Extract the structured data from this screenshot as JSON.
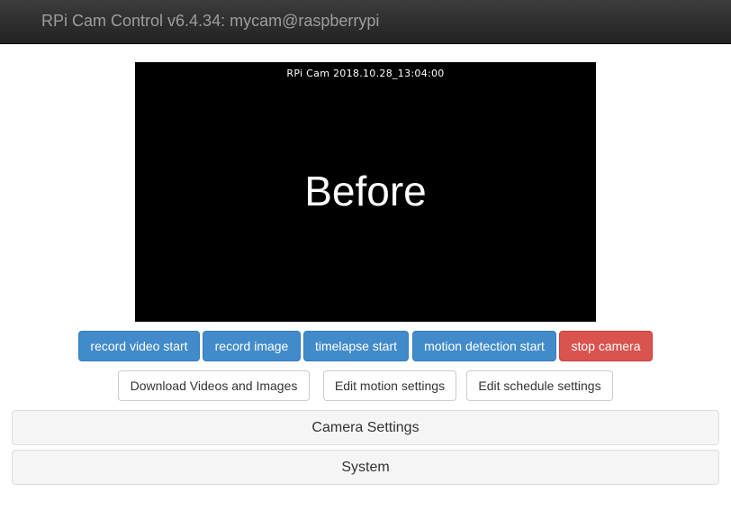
{
  "header": {
    "title": "RPi Cam Control v6.4.34: mycam@raspberrypi"
  },
  "preview": {
    "overlay_text": "RPi  Cam  2018.10.28_13:04:00",
    "caption": "Before"
  },
  "action_buttons": {
    "record_video": "record video start",
    "record_image": "record image",
    "timelapse": "timelapse start",
    "motion_detection": "motion detection start",
    "stop_camera": "stop camera"
  },
  "secondary_buttons": {
    "download": "Download Videos and Images",
    "edit_motion": "Edit motion settings",
    "edit_schedule": "Edit schedule settings"
  },
  "panels": {
    "camera_settings": "Camera Settings",
    "system": "System"
  },
  "colors": {
    "navbar": "#222222",
    "primary": "#428bca",
    "danger": "#d9534f",
    "panel": "#f5f5f5"
  }
}
